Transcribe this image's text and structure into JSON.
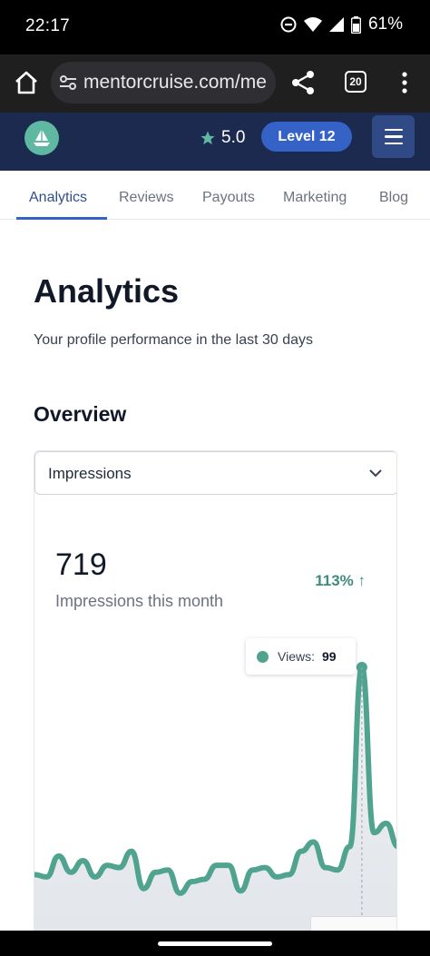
{
  "status": {
    "time": "22:17",
    "battery": "61%",
    "icons": [
      "dnd-icon",
      "wifi-icon",
      "signal-icon",
      "battery-icon"
    ]
  },
  "browser": {
    "url": "mentorcruise.com/me",
    "tab_count": "20"
  },
  "header": {
    "rating": "5.0",
    "level": "Level 12",
    "colors": {
      "bg": "#1b2a4e",
      "logo": "#5fb8a1",
      "level_bg": "#3562c7"
    }
  },
  "tabs": [
    {
      "label": "Analytics",
      "active": true
    },
    {
      "label": "Reviews"
    },
    {
      "label": "Payouts"
    },
    {
      "label": "Marketing"
    },
    {
      "label": "Blog"
    }
  ],
  "page": {
    "title": "Analytics",
    "subtitle": "Your profile performance in the last 30 days",
    "section": "Overview"
  },
  "metric": {
    "selected": "Impressions",
    "value": "719",
    "label": "Impressions this month",
    "change": "113% ↑"
  },
  "chart_data": {
    "type": "area",
    "series": [
      {
        "name": "Views",
        "values": [
          10,
          9,
          18,
          11,
          16,
          9,
          14,
          13,
          20,
          4,
          11,
          12,
          2,
          7,
          8,
          14,
          14,
          3,
          12,
          13,
          9,
          10,
          20,
          24,
          13,
          12,
          22,
          99,
          28,
          32,
          22
        ]
      }
    ],
    "ylim": [
      0,
      100
    ],
    "tooltip": {
      "label": "Views:",
      "value": "99"
    },
    "highlight_index": 27,
    "color": "#4fa38f"
  }
}
